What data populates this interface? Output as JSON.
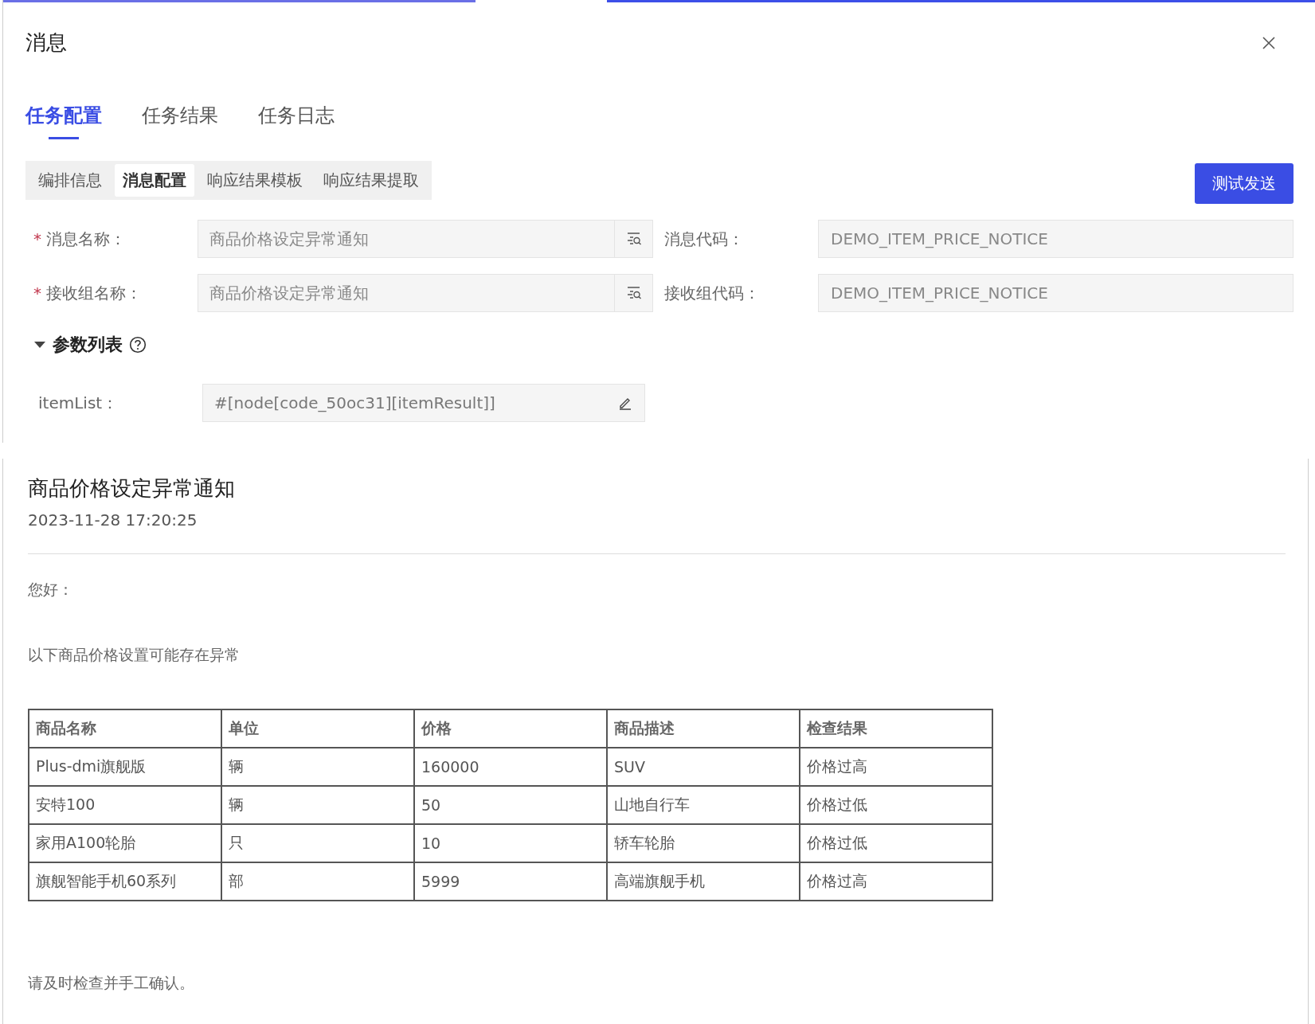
{
  "dialog": {
    "title": "消息",
    "tabs": [
      {
        "label": "任务配置",
        "selected": true
      },
      {
        "label": "任务结果",
        "selected": false
      },
      {
        "label": "任务日志",
        "selected": false
      }
    ],
    "segments": [
      {
        "label": "编排信息",
        "selected": false
      },
      {
        "label": "消息配置",
        "selected": true
      },
      {
        "label": "响应结果模板",
        "selected": false
      },
      {
        "label": "响应结果提取",
        "selected": false
      }
    ],
    "test_button": "测试发送",
    "form_rows": [
      {
        "label": "消息名称：",
        "required_mark": "*",
        "value": "商品价格设定异常通知",
        "code_label": "消息代码：",
        "code_value": "DEMO_ITEM_PRICE_NOTICE"
      },
      {
        "label": "接收组名称：",
        "required_mark": "*",
        "value": "商品价格设定异常通知",
        "code_label": "接收组代码：",
        "code_value": "DEMO_ITEM_PRICE_NOTICE"
      }
    ],
    "params": {
      "title": "参数列表",
      "expanded": true,
      "items": [
        {
          "label": "itemList：",
          "value": "#[node[code_50oc31][itemResult]]"
        }
      ]
    }
  },
  "preview": {
    "title": "商品价格设定异常通知",
    "date": "2023-11-28 17:20:25",
    "greeting": "您好：",
    "intro": "以下商品价格设置可能存在异常",
    "table": {
      "columns": [
        "商品名称",
        "单位",
        "价格",
        "商品描述",
        "检查结果"
      ],
      "rows": [
        [
          "Plus-dmi旗舰版",
          "辆",
          "160000",
          "SUV",
          "价格过高"
        ],
        [
          "安特100",
          "辆",
          "50",
          "山地自行车",
          "价格过低"
        ],
        [
          "家用A100轮胎",
          "只",
          "10",
          "轿车轮胎",
          "价格过低"
        ],
        [
          "旗舰智能手机60系列",
          "部",
          "5999",
          "高端旗舰手机",
          "价格过高"
        ]
      ]
    },
    "footer": "请及时检查并手工确认。"
  }
}
